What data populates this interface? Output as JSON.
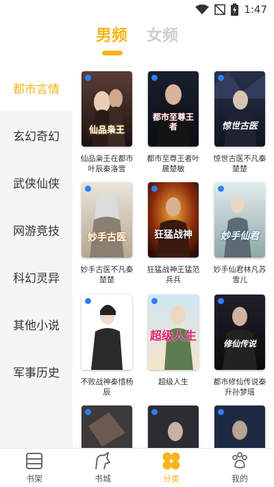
{
  "status_bar": {
    "time": "1:47"
  },
  "gender_tabs": [
    {
      "label": "男频",
      "active": true
    },
    {
      "label": "女频",
      "active": false
    }
  ],
  "sidebar": {
    "items": [
      {
        "label": "都市言情",
        "active": true
      },
      {
        "label": "玄幻奇幻",
        "active": false
      },
      {
        "label": "武侠仙侠",
        "active": false
      },
      {
        "label": "网游竞技",
        "active": false
      },
      {
        "label": "科幻灵异",
        "active": false
      },
      {
        "label": "其他小说",
        "active": false
      },
      {
        "label": "军事历史",
        "active": false
      }
    ]
  },
  "books": [
    {
      "title": "仙品枭王在都市叶辰秦洛雪",
      "cover_text": "仙品枭王"
    },
    {
      "title": "都市至尊王者叶晨楚敏",
      "cover_text": "都市至尊王者"
    },
    {
      "title": "惊世古医不凡秦楚楚",
      "cover_text": "惊世古医"
    },
    {
      "title": "妙手古医不凡秦楚楚",
      "cover_text": "妙手古医"
    },
    {
      "title": "狂猛战神王猛范兵兵",
      "cover_text": "狂猛战神"
    },
    {
      "title": "妙手仙君林凡苏雪儿",
      "cover_text": "妙手仙君"
    },
    {
      "title": "不败战神秦惜杨辰",
      "cover_text": ""
    },
    {
      "title": "超级人生",
      "cover_text": "超级人生"
    },
    {
      "title": "都市修仙传说秦升孙梦瑶",
      "cover_text": "修仙传说"
    },
    {
      "title": "",
      "cover_text": ""
    },
    {
      "title": "",
      "cover_text": ""
    },
    {
      "title": "",
      "cover_text": ""
    }
  ],
  "bottom_nav": [
    {
      "label": "书架",
      "icon": "bookshelf-icon",
      "active": false
    },
    {
      "label": "书城",
      "icon": "bookstore-icon",
      "active": false
    },
    {
      "label": "分类",
      "icon": "category-icon",
      "active": true
    },
    {
      "label": "我的",
      "icon": "paw-icon",
      "active": false
    }
  ],
  "colors": {
    "accent": "#f7b519",
    "sidebar_bg": "#f5f5f5",
    "inactive_tab": "#cfcfcf"
  }
}
